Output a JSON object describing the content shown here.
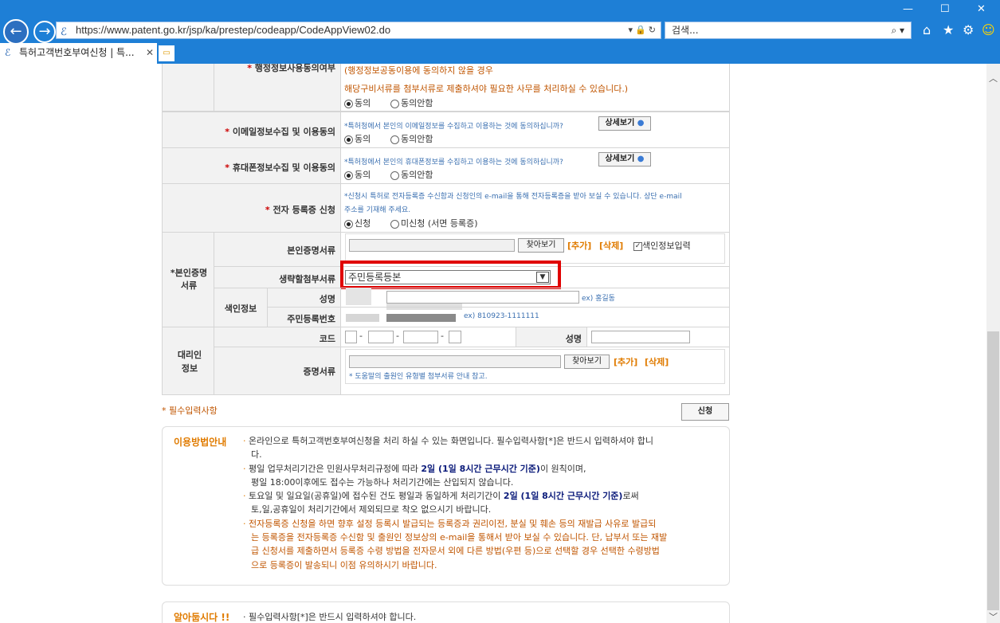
{
  "browser": {
    "url": "https://www.patent.go.kr/jsp/ka/prestep/codeapp/CodeAppView02.do",
    "search_placeholder": "검색...",
    "tab_title": "특허고객번호부여신청 | 특...",
    "back": "←",
    "forward": "→",
    "minimize": "—",
    "maximize": "☐",
    "close": "✕"
  },
  "form": {
    "admin_info_label": "행정정보사용동의여부",
    "admin_info_l1": "(행정정보공동이용에 동의하지 않을 경우",
    "admin_info_l2": "해당구비서류를 첨부서류로 제출하셔야 필요한 사무를 처리하실 수 있습니다.)",
    "agree": "동의",
    "disagree": "동의안함",
    "email_label": "이메일정보수집 및 이용동의",
    "email_desc": "*특허청에서 본인의 이메일정보를 수집하고 이용하는 것에 동의하십니까?",
    "detail_btn": "상세보기",
    "phone_label": "휴대폰정보수집 및 이용동의",
    "phone_desc": "*특허청에서 본인의 휴대폰정보를 수집하고 이용하는 것에 동의하십니까?",
    "ecert_label": "전자 등록증 신청",
    "ecert_desc1": "*신청시 특허로 전자등록증 수신함과 신청인의 e-mail을 통해 전자등록증을 받아 보실 수 있습니다. 상단 e-mail",
    "ecert_desc2": "주소를 기재해 주세요.",
    "apply": "신청",
    "not_apply": "미신청 (서면 등록증)",
    "self_docs_label": "*본인증명서류",
    "self_cert_label": "본인증명서류",
    "browse": "찾아보기",
    "add": "[추가]",
    "delete": "[삭제]",
    "index_input": "색인정보입력",
    "omit_label": "생략할첨부서류",
    "omit_value": "주민등록등본",
    "index_label": "색인정보",
    "name_label": "성명",
    "name_ex": "ex) 홍길동",
    "rrn_label": "주민등록번호",
    "rrn_ex": "ex) 810923-1111111",
    "agent_label": "대리인정보",
    "code_label": "코드",
    "agent_name_label": "성명",
    "cert_docs_label": "증명서류",
    "help_note": "* 도움말의 출원인 유형별 첨부서류 안내 참고.",
    "required_note": "* 필수입력사항",
    "submit": "신청"
  },
  "guide": {
    "title": "이용방법안내",
    "l1": "온라인으로 특허고객번호부여신청을 처리 하실 수 있는 화면입니다. 필수입력사항[*]은 반드시 입력하셔야 합니",
    "l1b": "다.",
    "l2a": "평일 업무처리기간은 민원사무처리규정에 따라 ",
    "l2bold": "2일 (1일 8시간 근무시간 기준)",
    "l2c": "이 원칙이며,",
    "l3": "평일 18:00이후에도 접수는 가능하나 처리기간에는 산입되지 않습니다.",
    "l4a": "토요일 및 일요일(공휴일)에 접수된 건도 평일과 동일하게 처리기간이 ",
    "l4bold": "2일 (1일 8시간 근무시간 기준)",
    "l4c": "로써",
    "l5": "토,일,공휴일이 처리기간에서 제외되므로 착오 없으시기 바랍니다.",
    "l6": "전자등록증 신청을 하면 향후 설정 등록시 발급되는 등록증과 권리이전, 분실 및 훼손 등의 재발급 사유로 발급되",
    "l7": "는 등록증을 전자등록증 수신함 및 출원인 정보상의 e-mail을 통해서 받아 보실 수 있습니다. 단, 납부서 또는 재발",
    "l8": "급 신청서를 제출하면서 등록증 수령 방법을 전자문서 외에 다른 방법(우편 등)으로 선택할 경우 선택한 수령방법",
    "l9": "으로 등록증이 발송되니 이점 유의하시기 바랍니다."
  },
  "notice": {
    "title": "알아둡시다 !!",
    "l1": "필수입력사항[*]은 반드시 입력하셔야 합니다."
  }
}
